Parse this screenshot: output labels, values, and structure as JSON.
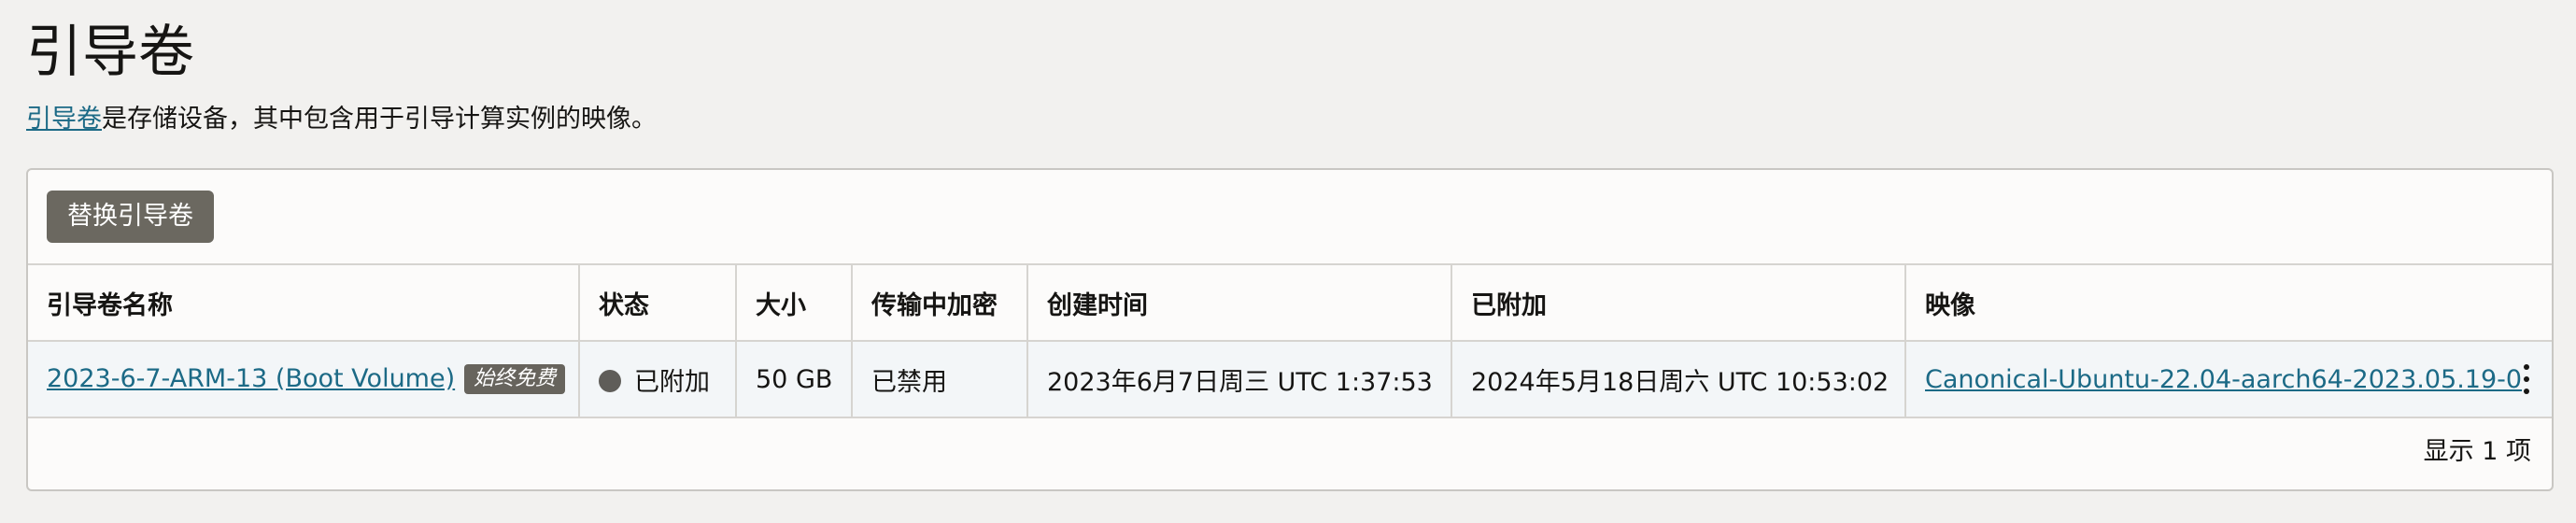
{
  "page": {
    "title": "引导卷",
    "subtitle_link": "引导卷",
    "subtitle_text": "是存储设备，其中包含用于引导计算实例的映像。"
  },
  "toolbar": {
    "replace_label": "替换引导卷"
  },
  "table": {
    "columns": [
      "引导卷名称",
      "状态",
      "大小",
      "传输中加密",
      "创建时间",
      "已附加",
      "映像"
    ],
    "rows": [
      {
        "name": "2023-6-7-ARM-13 (Boot Volume)",
        "badge": "始终免费",
        "status": "已附加",
        "size": "50 GB",
        "encryption": "已禁用",
        "created": "2023年6月7日周三 UTC 1:37:53",
        "attached": "2024年5月18日周六 UTC 10:53:02",
        "image": "Canonical-Ubuntu-22.04-aarch64-2023.05.19-0"
      }
    ]
  },
  "footer": {
    "count": "显示 1 项"
  },
  "colors": {
    "link": "#1c6a86",
    "button": "#6b6860",
    "badge": "#67645d",
    "status_dot": "#5f5d59"
  },
  "icons": {
    "status": "status-dot-icon",
    "row_actions": "kebab-menu-icon"
  }
}
